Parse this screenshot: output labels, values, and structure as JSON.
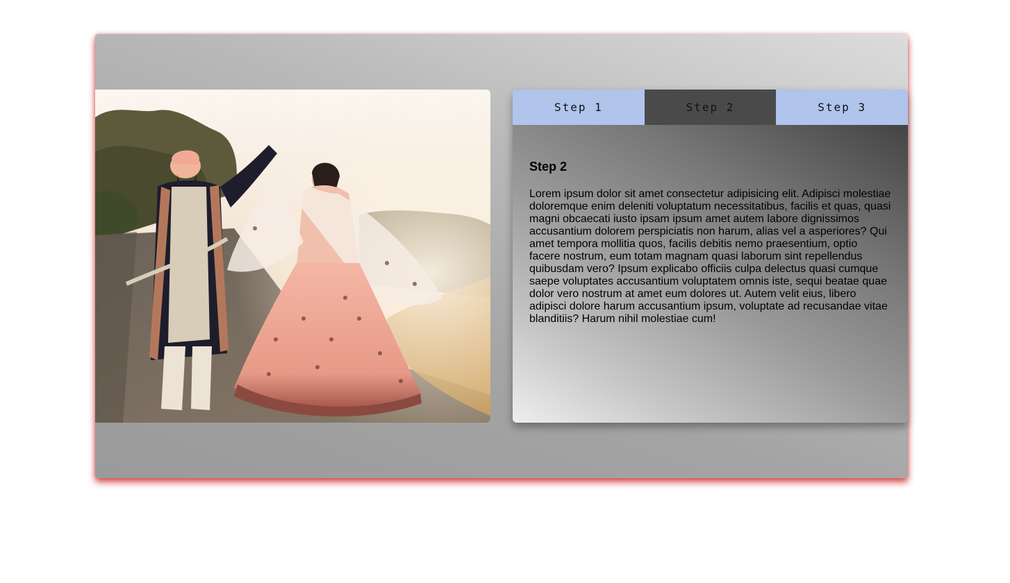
{
  "tabs": [
    {
      "label": "Step 1",
      "active": false
    },
    {
      "label": "Step 2",
      "active": true
    },
    {
      "label": "Step 3",
      "active": false
    }
  ],
  "content": {
    "heading": "Step 2",
    "body": "Lorem ipsum dolor sit amet consectetur adipisicing elit. Adipisci molestiae doloremque enim deleniti voluptatum necessitatibus, facilis et quas, quasi magni obcaecati iusto ipsam ipsum amet autem labore dignissimos accusantium dolorem perspiciatis non harum, alias vel a asperiores? Qui amet tempora mollitia quos, facilis debitis nemo praesentium, optio facere nostrum, eum totam magnam quasi laborum sint repellendus quibusdam vero? Ipsum explicabo officiis culpa delectus quasi cumque saepe voluptates accusantium voluptatem omnis iste, sequi beatae quae dolor vero nostrum at amet eum dolores ut. Autem velit eius, libero adipisci dolore harum accusantium ipsum, voluptate ad recusandae vitae blanditiis? Harum nihil molestiae cum!"
  },
  "colors": {
    "tab_inactive": "#b0c4ec",
    "tab_active": "#4a4a4a",
    "card_shadow": "#c81e1e"
  }
}
